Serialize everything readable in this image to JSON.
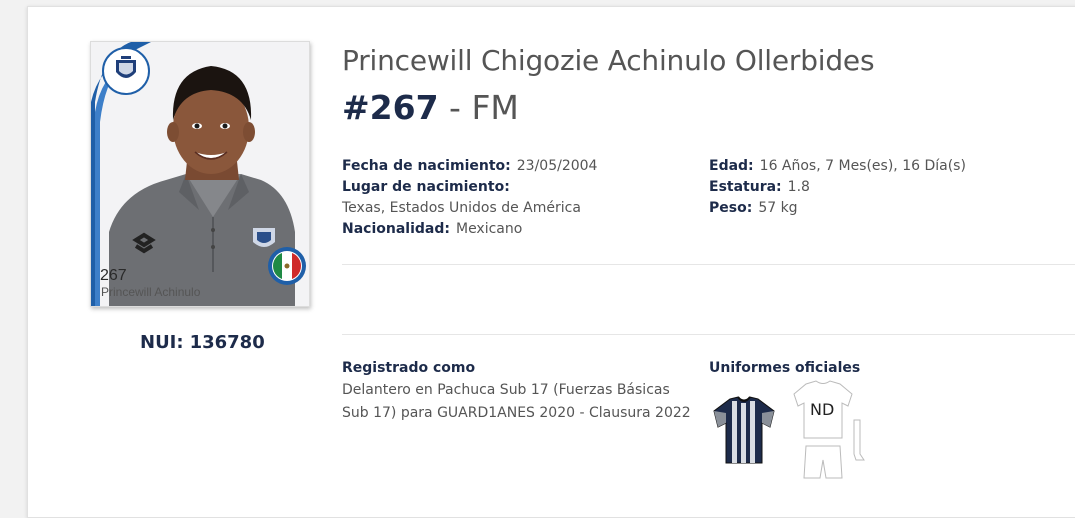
{
  "player": {
    "full_name": "Princewill Chigozie Achinulo Ollerbides",
    "number": "#267",
    "separator": " - ",
    "position": "FM",
    "nui_label": "NUI:",
    "nui_value": "136780"
  },
  "sticker": {
    "number": "267",
    "name": "Princewill Achinulo",
    "club_badge_icon": "pachuca-crest-icon",
    "flag_icon": "mexico-flag-icon"
  },
  "details": {
    "birth_date_label": "Fecha de nacimiento:",
    "birth_date": "23/05/2004",
    "birth_place_label": "Lugar de nacimiento:",
    "birth_place": "Texas, Estados Unidos de América",
    "nationality_label": "Nacionalidad:",
    "nationality": "Mexicano",
    "age_label": "Edad:",
    "age": "16 Años, 7 Mes(es), 16 Día(s)",
    "height_label": "Estatura:",
    "height": "1.8",
    "weight_label": "Peso:",
    "weight": "57 kg"
  },
  "registration": {
    "title": "Registrado como",
    "text": "Delantero en Pachuca Sub 17 (Fuerzas Básicas Sub 17) para GUARD1ANES 2020 - Clausura 2022"
  },
  "uniforms": {
    "title": "Uniformes oficiales",
    "away_label": "ND"
  },
  "colors": {
    "navy": "#1d2b4a",
    "text_gray": "#555555",
    "sticker_blue": "#1f5fa8"
  }
}
